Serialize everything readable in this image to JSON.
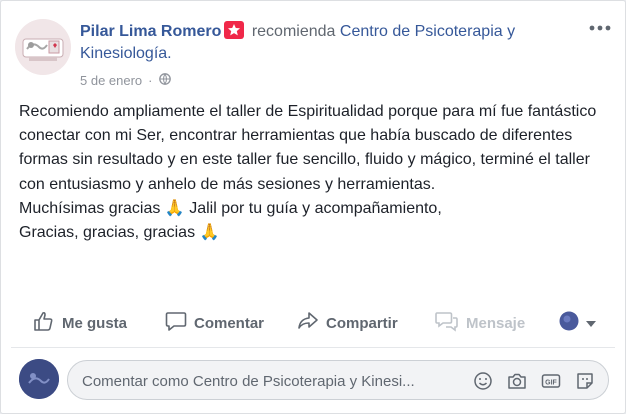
{
  "post": {
    "author": "Pilar Lima Romero",
    "recommends_text": "recomienda",
    "page_name": "Centro de Psicoterapia y Kinesiología.",
    "date": "5 de enero",
    "privacy_icon": "globe-icon",
    "more_icon": "more-options-icon",
    "body": "Recomiendo ampliamente el taller de Espiritualidad porque para mí fue fantástico conectar con mi Ser, encontrar herramientas que había buscado de diferentes formas sin resultado y en este taller fue sencillo, fluido y mágico, terminé el taller con entusiasmo y anhelo de más sesiones y herramientas.\nMuchísimas gracias 🙏 Jalil por tu guía y acompañamiento,\nGracias, gracias, gracias 🙏"
  },
  "actions": {
    "like": "Me gusta",
    "comment": "Comentar",
    "share": "Compartir",
    "message": "Mensaje"
  },
  "comment": {
    "placeholder": "Comentar como Centro de Psicoterapia y Kinesi..."
  },
  "colors": {
    "link": "#365899",
    "text": "#1d2129",
    "muted": "#606770",
    "badge": "#f02849"
  }
}
